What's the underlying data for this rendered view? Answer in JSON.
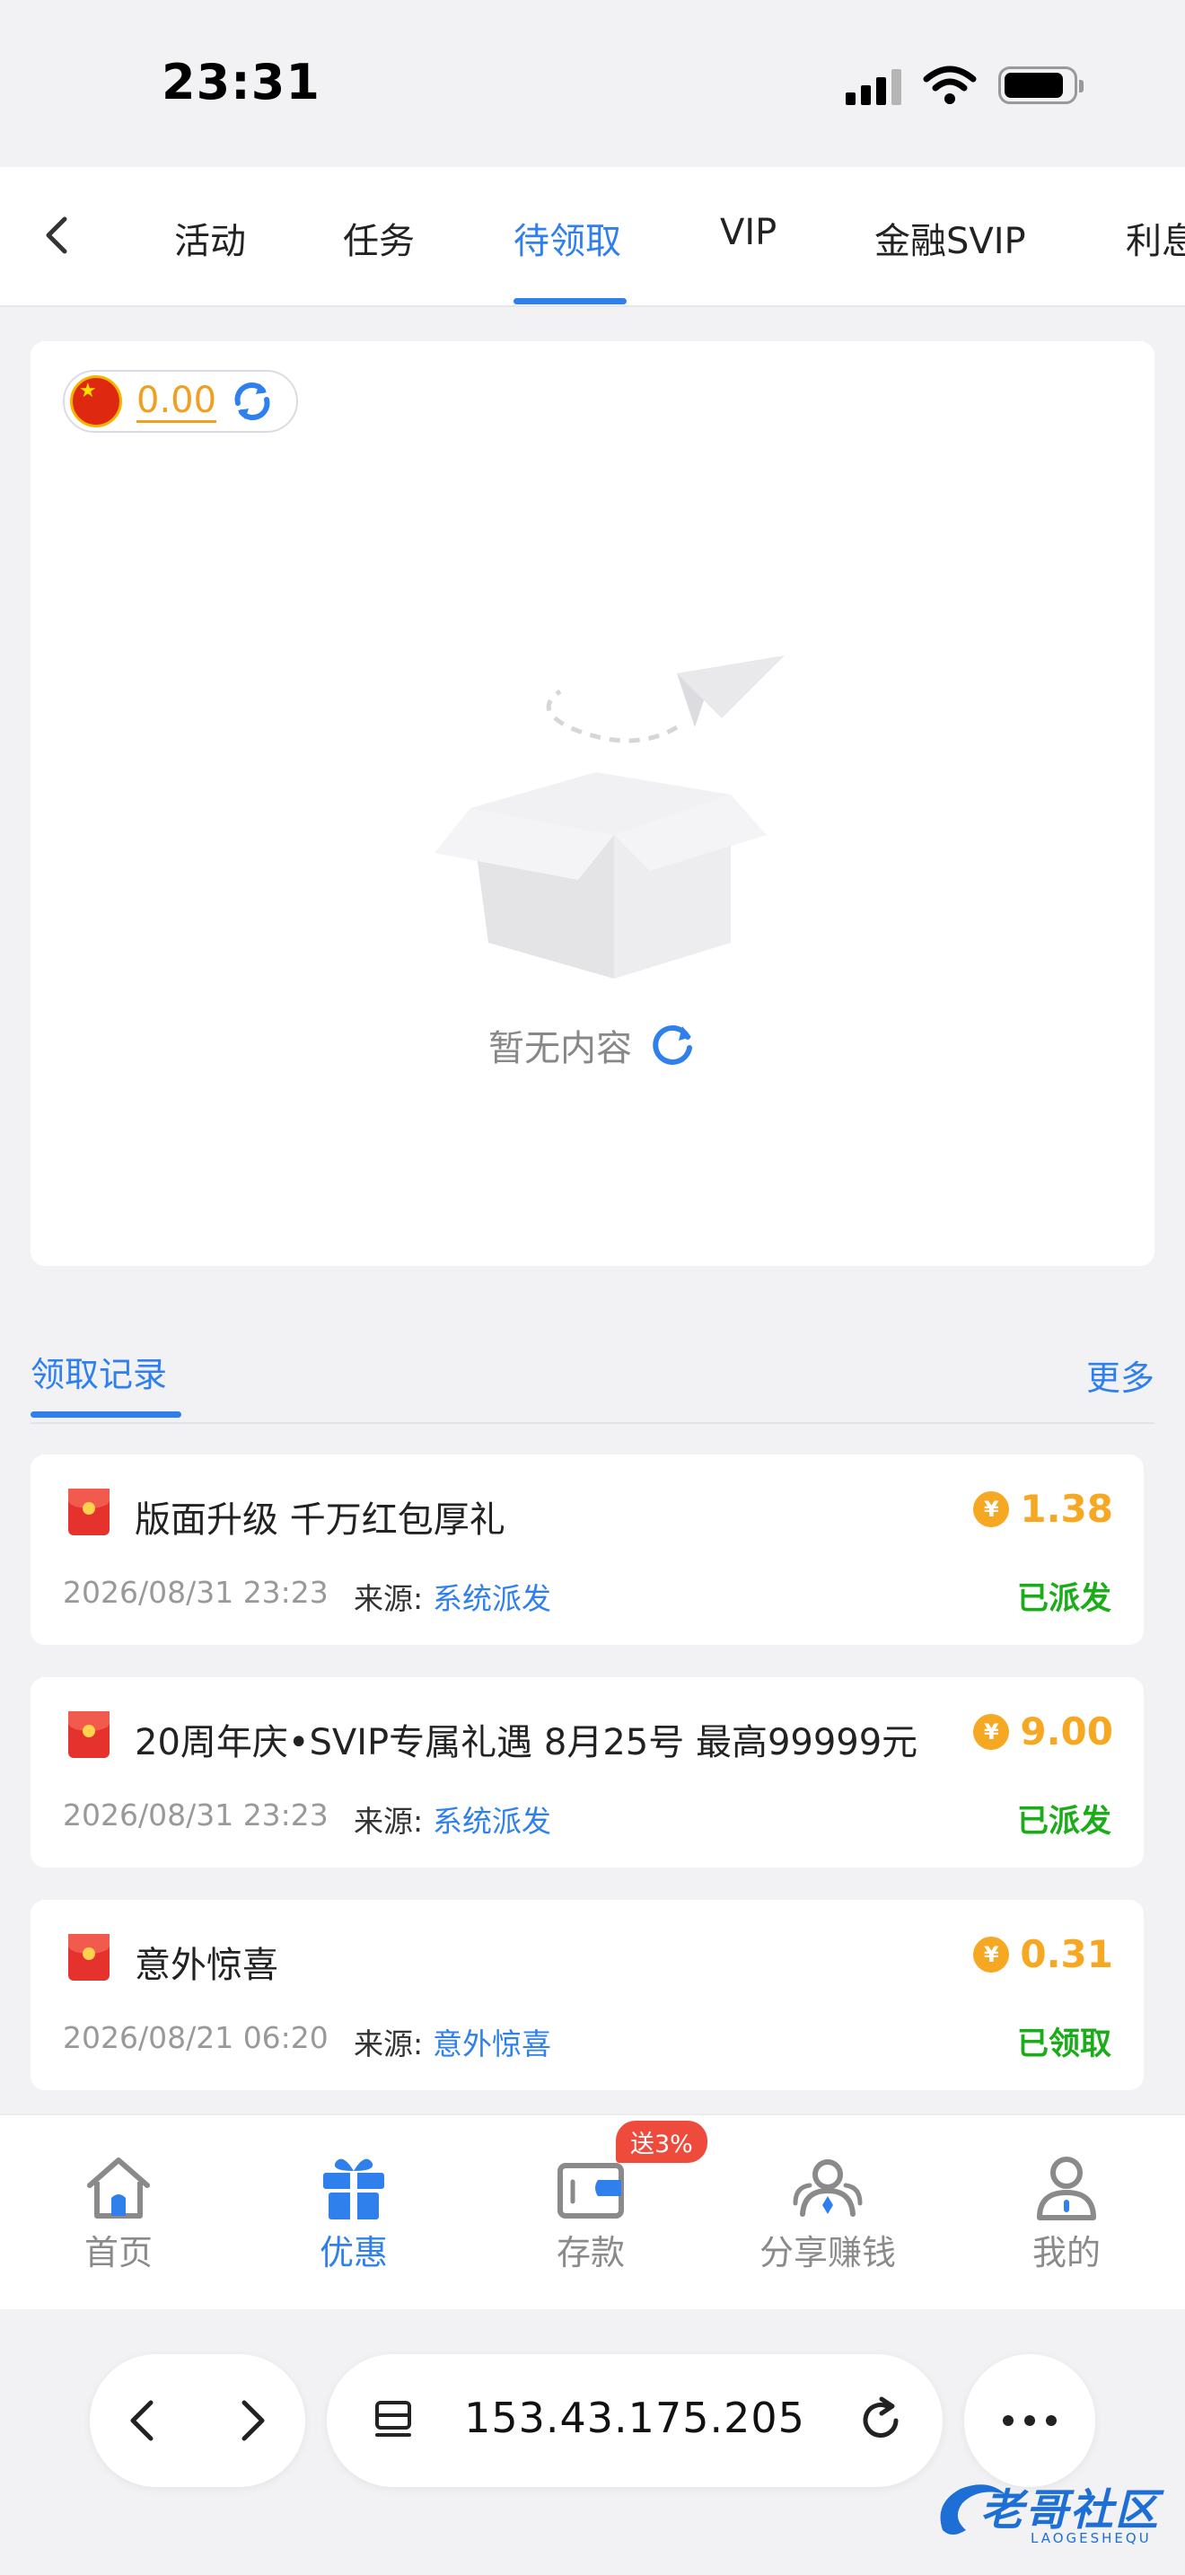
{
  "status_bar": {
    "time": "23:31"
  },
  "tabs": [
    "活动",
    "任务",
    "待领取",
    "VIP",
    "金融SVIP",
    "利息"
  ],
  "active_tab": "待领取",
  "balance": {
    "value": "0.00"
  },
  "empty_state": {
    "text": "暂无内容"
  },
  "records": {
    "title": "领取记录",
    "more": "更多",
    "source_label": "来源:",
    "items": [
      {
        "title": "版面升级 千万红包厚礼",
        "amount": "1.38",
        "time": "2026/08/31 23:23",
        "source": "系统派发",
        "status": "已派发"
      },
      {
        "title": "20周年庆•SVIP专属礼遇 8月25号 最高99999元",
        "amount": "9.00",
        "time": "2026/08/31 23:23",
        "source": "系统派发",
        "status": "已派发"
      },
      {
        "title": "意外惊喜",
        "amount": "0.31",
        "time": "2026/08/21 06:20",
        "source": "意外惊喜",
        "status": "已领取"
      }
    ]
  },
  "bottom_nav": {
    "items": [
      {
        "label": "首页",
        "icon": "home-icon"
      },
      {
        "label": "优惠",
        "icon": "gift-icon",
        "active": true
      },
      {
        "label": "存款",
        "icon": "wallet-icon"
      },
      {
        "label": "分享赚钱",
        "icon": "share-people-icon"
      },
      {
        "label": "我的",
        "icon": "user-icon"
      }
    ],
    "promo_badge": "送3%"
  },
  "browser": {
    "address": "153.43.175.205"
  },
  "watermark": {
    "text": "老哥社区",
    "subtext": "LAOGESHEQU"
  },
  "colors": {
    "accent": "#2f80ed",
    "amount": "#f7a823",
    "status": "#1aad19",
    "badge": "#ee4b3c"
  }
}
